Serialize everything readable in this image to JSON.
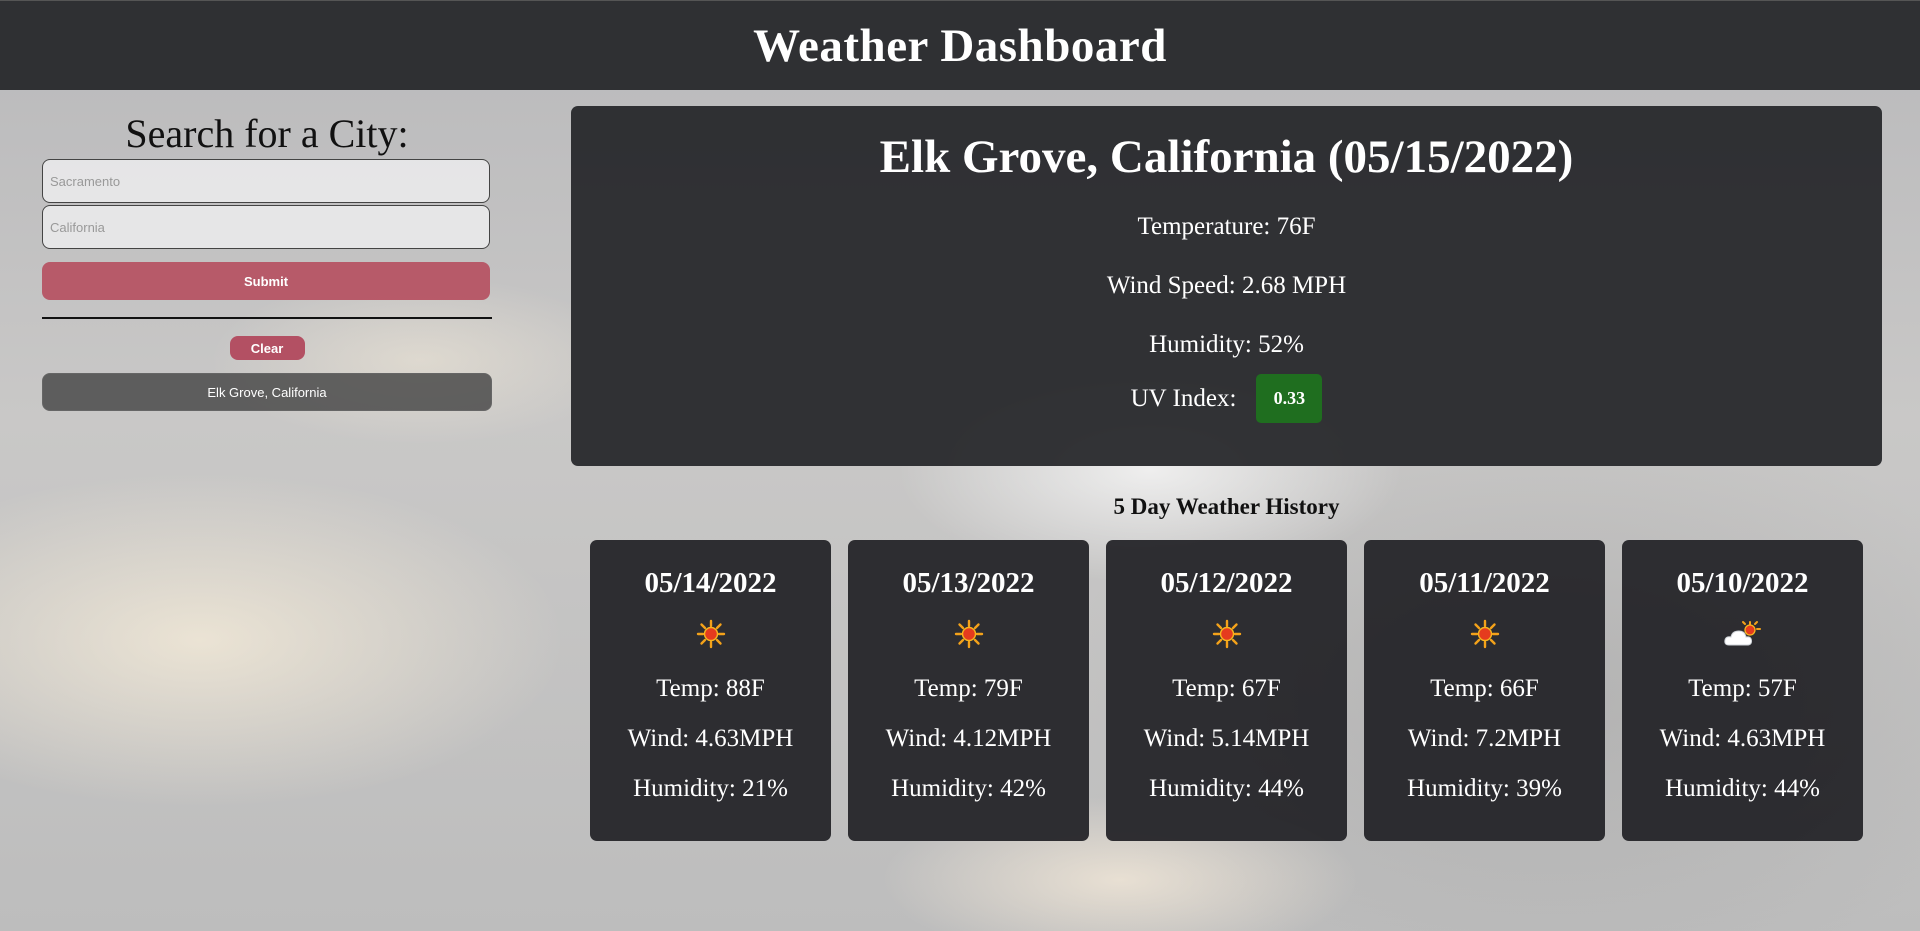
{
  "header": {
    "title": "Weather Dashboard"
  },
  "sidebar": {
    "title": "Search for a City:",
    "city_placeholder": "Sacramento",
    "state_placeholder": "California",
    "submit_label": "Submit",
    "clear_label": "Clear",
    "history": [
      "Elk Grove, California"
    ]
  },
  "current": {
    "heading": "Elk Grove, California (05/15/2022)",
    "temperature": "Temperature: 76F",
    "wind": "Wind Speed: 2.68 MPH",
    "humidity": "Humidity: 52%",
    "uv_label": "UV Index:",
    "uv_value": "0.33",
    "uv_color": "#1f6e1f"
  },
  "forecast": {
    "title": "5 Day Weather History",
    "days": [
      {
        "date": "05/14/2022",
        "icon": "sun-icon",
        "temp": "Temp: 88F",
        "wind": "Wind: 4.63MPH",
        "humidity": "Humidity: 21%"
      },
      {
        "date": "05/13/2022",
        "icon": "sun-icon",
        "temp": "Temp: 79F",
        "wind": "Wind: 4.12MPH",
        "humidity": "Humidity: 42%"
      },
      {
        "date": "05/12/2022",
        "icon": "sun-icon",
        "temp": "Temp: 67F",
        "wind": "Wind: 5.14MPH",
        "humidity": "Humidity: 44%"
      },
      {
        "date": "05/11/2022",
        "icon": "sun-icon",
        "temp": "Temp: 66F",
        "wind": "Wind: 7.2MPH",
        "humidity": "Humidity: 39%"
      },
      {
        "date": "05/10/2022",
        "icon": "partly-cloudy-icon",
        "temp": "Temp: 57F",
        "wind": "Wind: 4.63MPH",
        "humidity": "Humidity: 44%"
      }
    ]
  },
  "colors": {
    "header_bg": "#2f3033",
    "accent": "#b35063",
    "card_bg": "#26272b"
  }
}
